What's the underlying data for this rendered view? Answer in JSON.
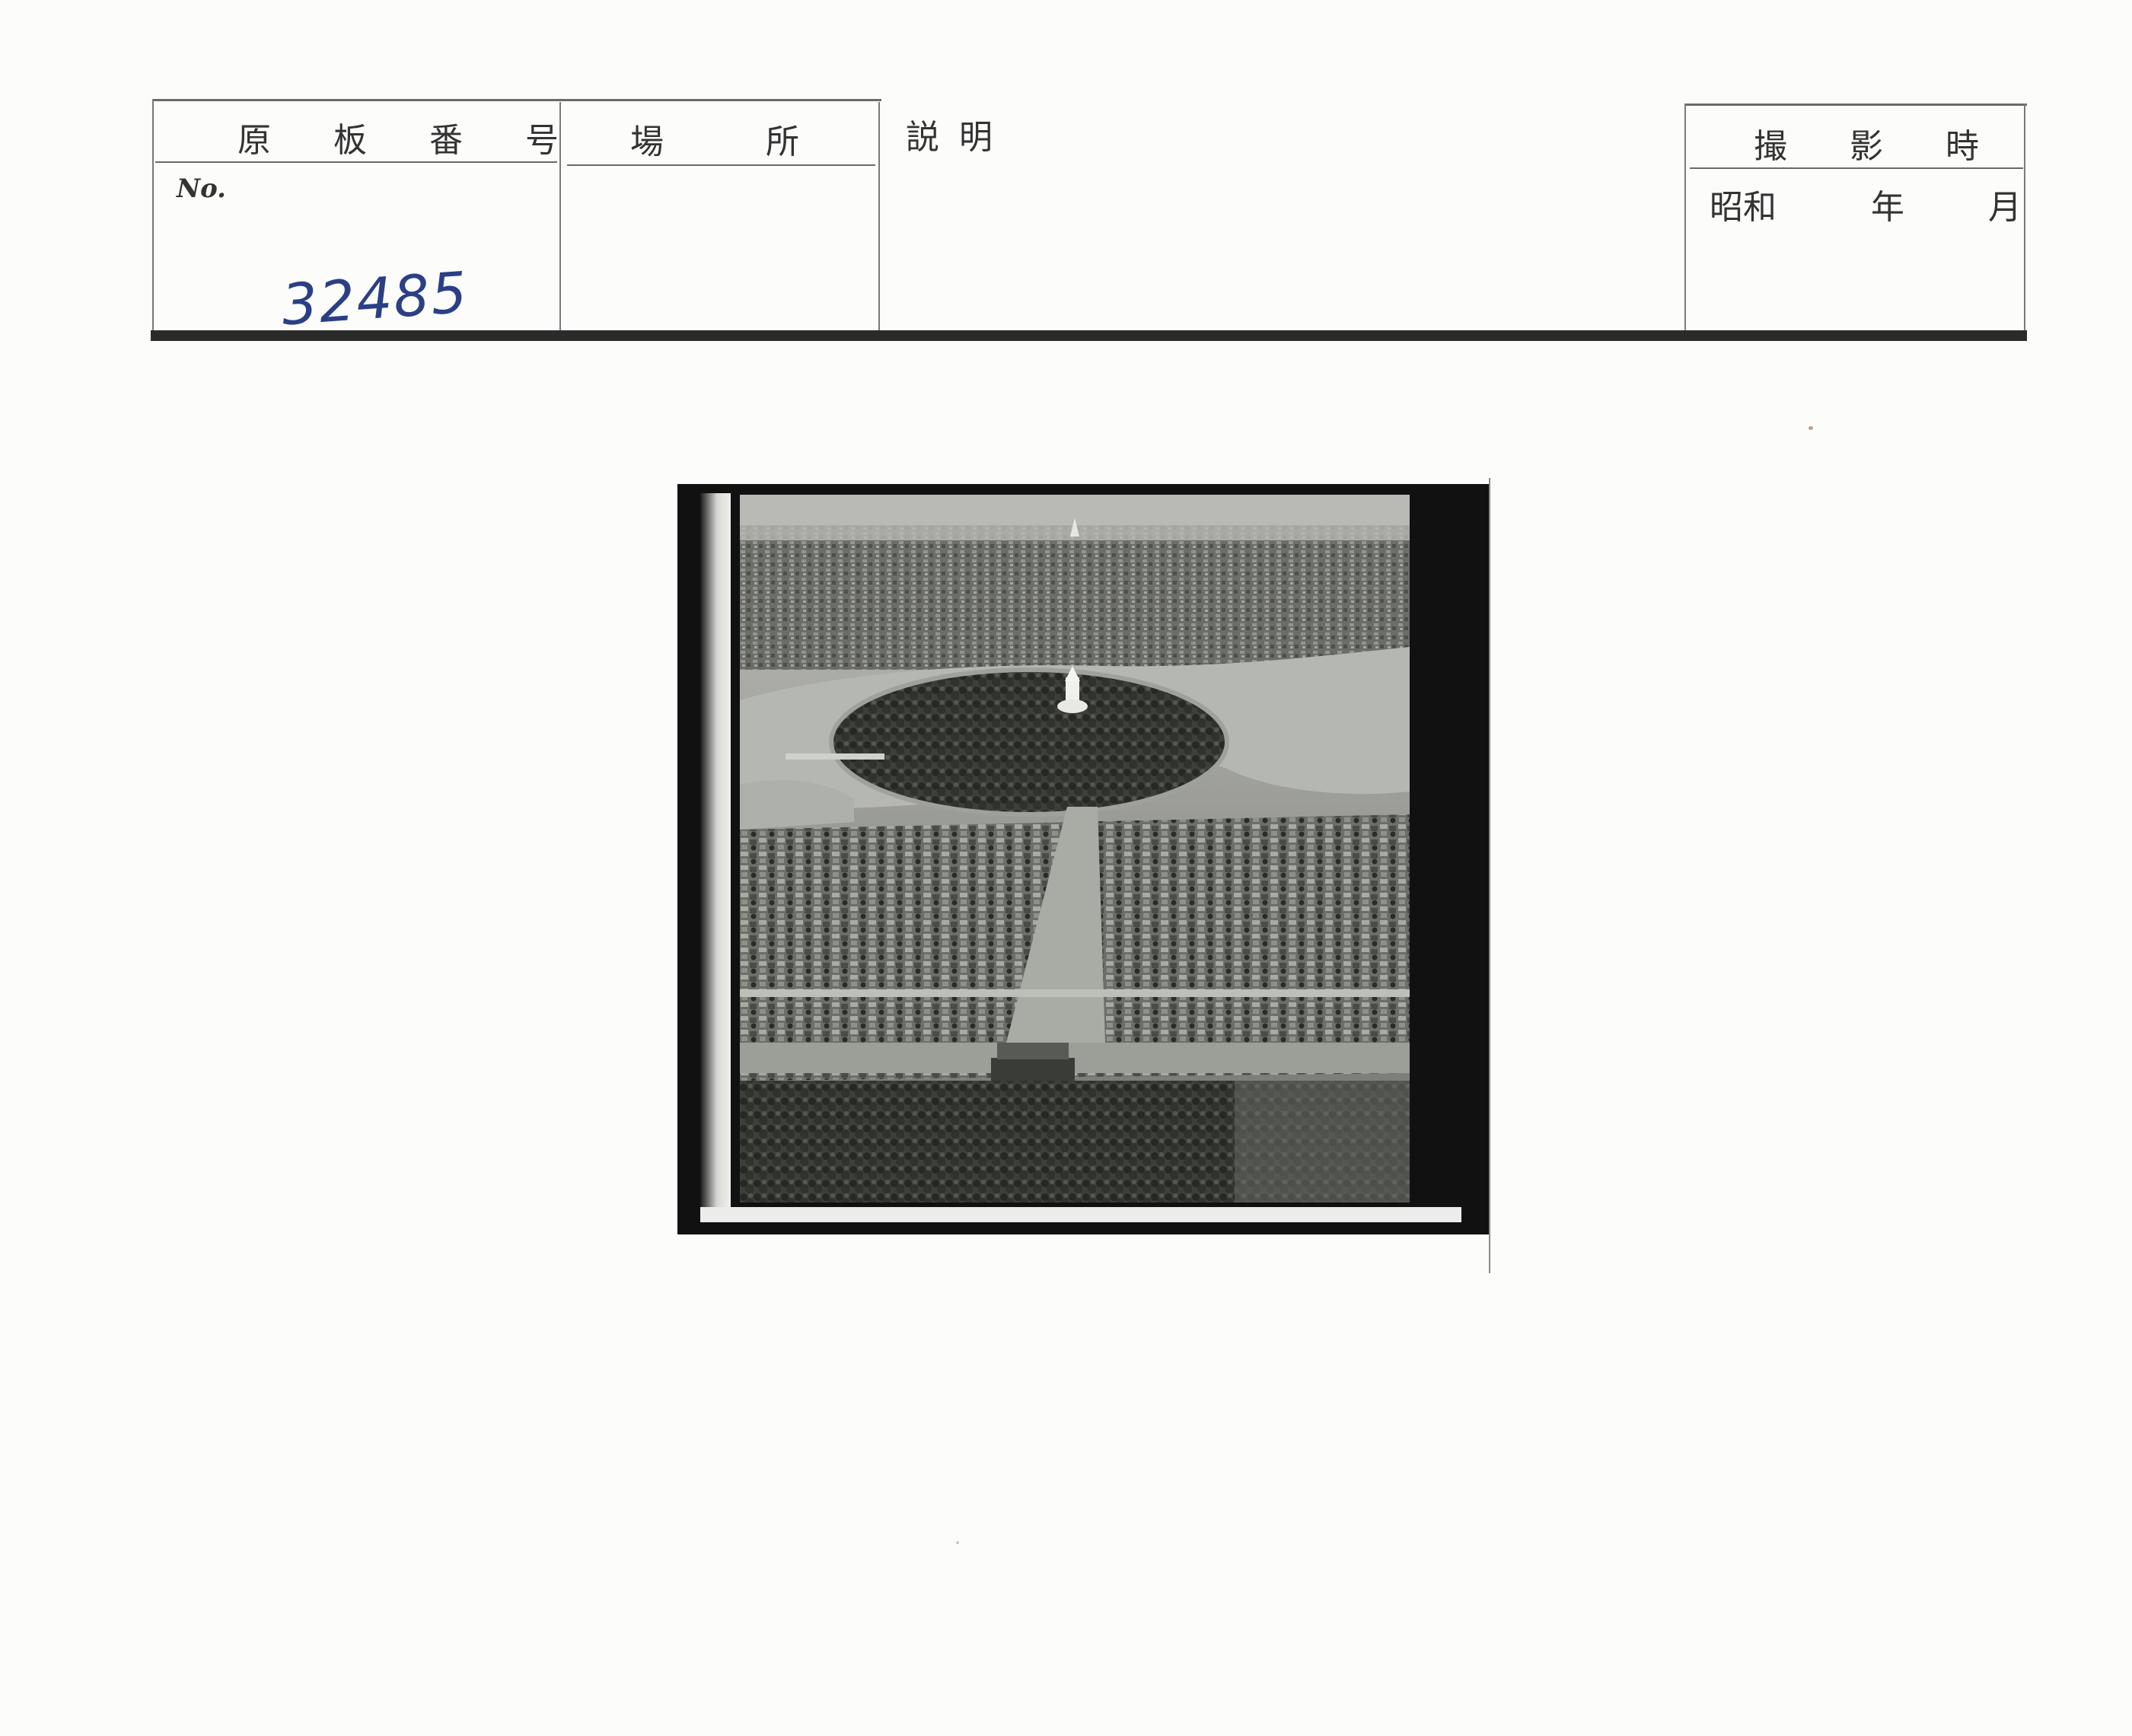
{
  "form": {
    "plate_number_label": "原 板 番 号",
    "location_label": "場 所",
    "description_label": "説 明",
    "date_taken_label": "撮 影 時",
    "no_label": "No.",
    "era_label": "昭和",
    "year_label": "年",
    "month_label": "月",
    "plate_number_value": "32485"
  },
  "photo": {
    "subject": "aerial-photograph",
    "tone": "black-and-white"
  }
}
